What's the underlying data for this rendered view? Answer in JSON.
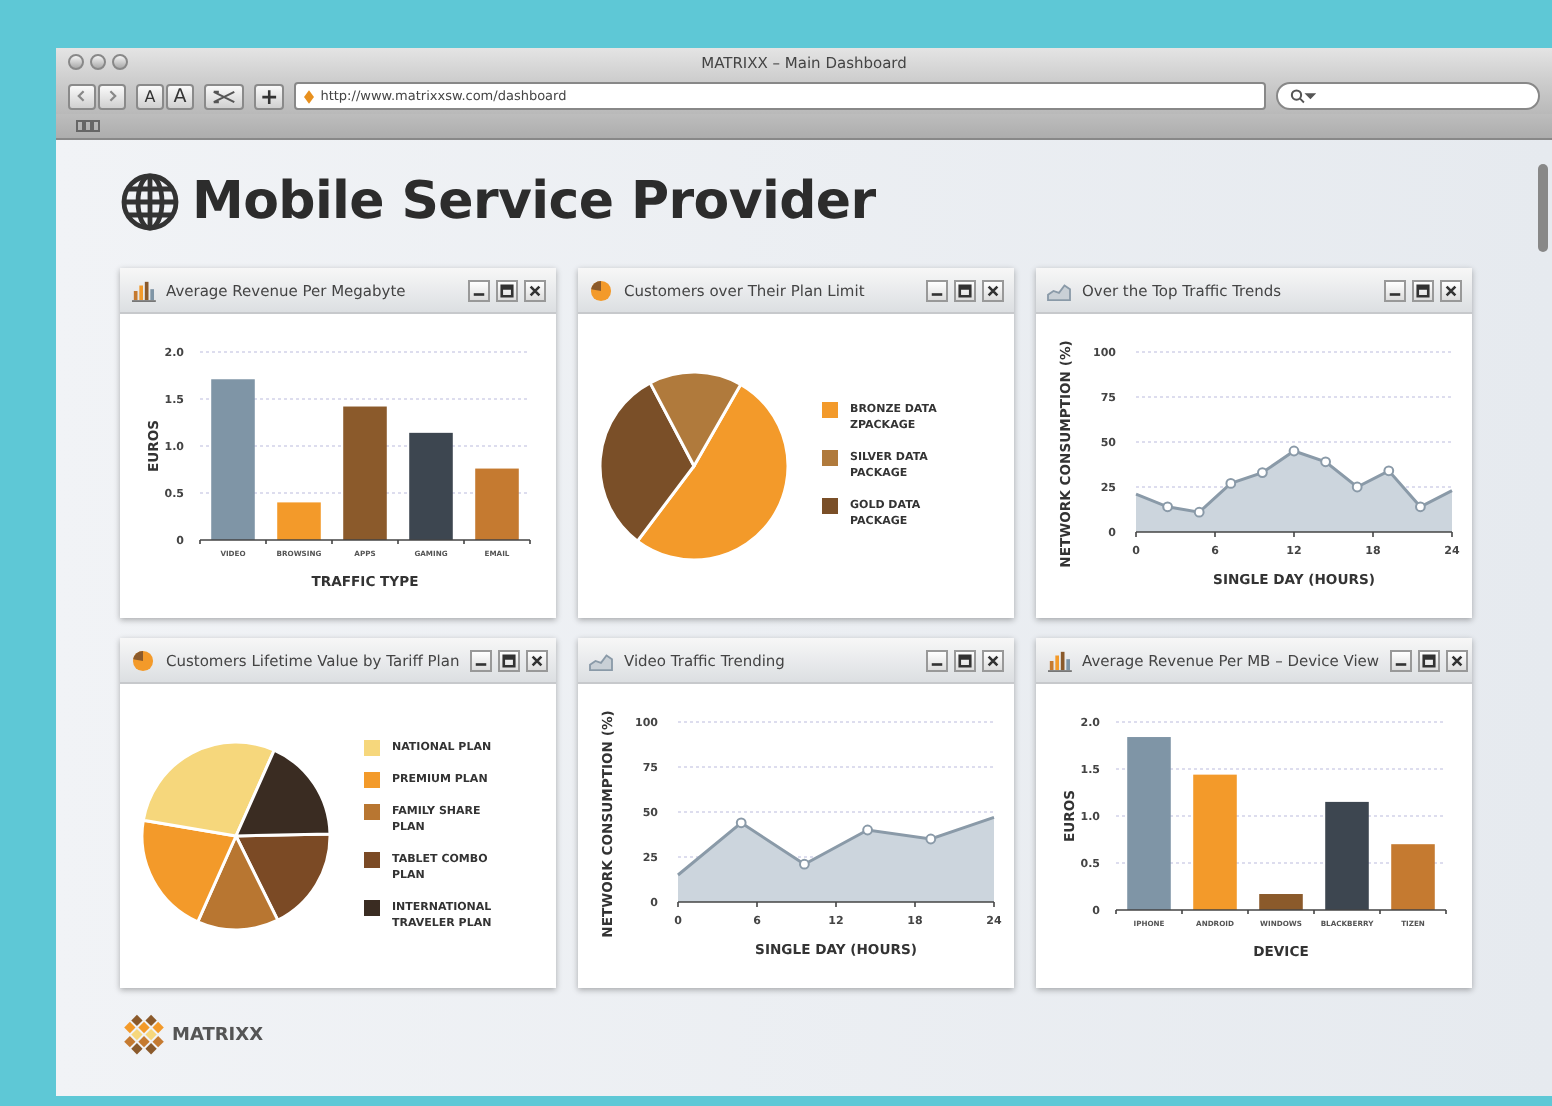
{
  "window": {
    "title": "MATRIXX – Main Dashboard"
  },
  "toolbar": {
    "url": "http://www.matrixxsw.com/dashboard",
    "font_buttons": [
      "A",
      "A"
    ],
    "add_button": "+"
  },
  "page": {
    "heading": "Mobile Service Provider"
  },
  "panels": [
    {
      "kind": "bar",
      "title": "Average Revenue Per Megabyte",
      "chart_data": {
        "type": "bar",
        "xlabel": "TRAFFIC TYPE",
        "ylabel": "EUROS",
        "categories": [
          "VIDEO",
          "BROWSING",
          "APPS",
          "GAMING",
          "EMAIL"
        ],
        "values": [
          1.71,
          0.4,
          1.42,
          1.14,
          0.76
        ],
        "grid": true,
        "colors": [
          "#7f95a6",
          "#f39a2a",
          "#8b5a2b",
          "#3d4650",
          "#c57a30"
        ],
        "ylim": [
          0,
          2
        ],
        "yticks": [
          {
            "value": 0,
            "label": "0"
          },
          {
            "value": 0.5,
            "label": "0.5"
          },
          {
            "value": 1,
            "label": "1.0"
          },
          {
            "value": 1.5,
            "label": "1.5"
          },
          {
            "value": 2,
            "label": "2.0"
          }
        ]
      }
    },
    {
      "kind": "pie",
      "title": "Customers over Their Plan Limit",
      "legend": [
        {
          "label": "BRONZE DATA ZPACKAGE",
          "color": "#f39a2a"
        },
        {
          "label": "SILVER DATA PACKAGE",
          "color": "#b07a3c"
        },
        {
          "label": "GOLD DATA PACKAGE",
          "color": "#7a4f28"
        }
      ]
    },
    {
      "kind": "line",
      "title": "Over the Top Traffic Trends",
      "chart_data": {
        "type": "area",
        "xlabel": "SINGLE DAY (HOURS)",
        "ylabel": "NETWORK CONSUMPTION (%)",
        "x": [
          0,
          2.4,
          4.8,
          7.2,
          9.6,
          12,
          14.4,
          16.8,
          19.2,
          21.6,
          24
        ],
        "values": [
          21,
          14,
          11,
          27,
          33,
          45,
          39,
          25,
          34,
          14,
          23
        ],
        "grid": true,
        "xlim": [
          0,
          24
        ],
        "ylim": [
          0,
          100
        ],
        "xticks": [
          0,
          6,
          12,
          18,
          24
        ],
        "yticks": [
          0,
          25,
          50,
          75,
          100
        ]
      }
    },
    {
      "kind": "pie",
      "title": "Customers Lifetime Value by Tariff Plan",
      "legend": [
        {
          "label": "NATIONAL PLAN",
          "color": "#f6d77c"
        },
        {
          "label": "PREMIUM PLAN",
          "color": "#f39a2a"
        },
        {
          "label": "FAMILY SHARE PLAN",
          "color": "#b87631"
        },
        {
          "label": "TABLET COMBO PLAN",
          "color": "#7b4a25"
        },
        {
          "label": "INTERNATIONAL TRAVELER PLAN",
          "color": "#3a2c22"
        }
      ]
    },
    {
      "kind": "line",
      "title": "Video Traffic Trending",
      "chart_data": {
        "type": "area",
        "xlabel": "SINGLE DAY (HOURS)",
        "ylabel": "NETWORK CONSUMPTION (%)",
        "x": [
          0,
          4.8,
          9.6,
          14.4,
          19.2,
          24
        ],
        "values": [
          15,
          44,
          21,
          40,
          35,
          47
        ],
        "grid": true,
        "xlim": [
          0,
          24
        ],
        "ylim": [
          0,
          100
        ],
        "xticks": [
          0,
          6,
          12,
          18,
          24
        ],
        "yticks": [
          0,
          25,
          50,
          75,
          100
        ]
      }
    },
    {
      "kind": "bar",
      "title": "Average Revenue Per MB – Device View",
      "chart_data": {
        "type": "bar",
        "xlabel": "DEVICE",
        "ylabel": "EUROS",
        "categories": [
          "IPHONE",
          "ANDROID",
          "WINDOWS",
          "BLACKBERRY",
          "TIZEN"
        ],
        "values": [
          1.84,
          1.44,
          0.17,
          1.15,
          0.7
        ],
        "grid": true,
        "colors": [
          "#7f95a6",
          "#f39a2a",
          "#8b5a2b",
          "#3d4650",
          "#c57a30"
        ],
        "ylim": [
          0,
          2
        ],
        "yticks": [
          {
            "value": 0,
            "label": "0"
          },
          {
            "value": 0.5,
            "label": "0.5"
          },
          {
            "value": 1,
            "label": "1.0"
          },
          {
            "value": 1.5,
            "label": "1.5"
          },
          {
            "value": 2,
            "label": "2.0"
          }
        ]
      }
    }
  ],
  "logo": {
    "text": "MATRIXX"
  }
}
